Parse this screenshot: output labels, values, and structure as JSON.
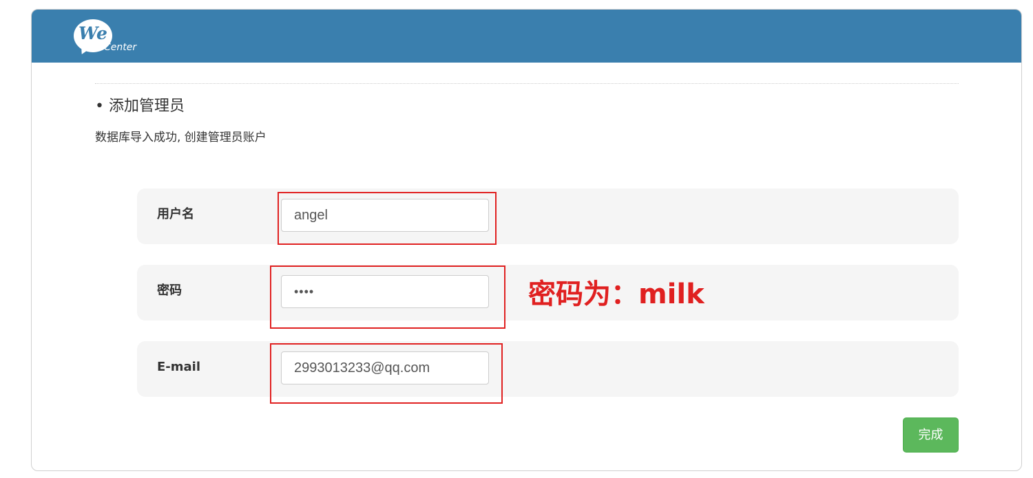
{
  "header": {
    "logo": {
      "we": "We",
      "center": "Center"
    },
    "color": "#3a7fae"
  },
  "section": {
    "title": "• 添加管理员",
    "description": "数据库导入成功, 创建管理员账户"
  },
  "form": {
    "username": {
      "label": "用户名",
      "value": "angel"
    },
    "password": {
      "label": "密码",
      "value": "••••"
    },
    "email": {
      "label": "E-mail",
      "value": "2993013233@qq.com"
    }
  },
  "annotation": {
    "note": "密码为：milk",
    "color": "#e02020"
  },
  "actions": {
    "finish_label": "完成",
    "finish_color": "#5cb85c"
  }
}
